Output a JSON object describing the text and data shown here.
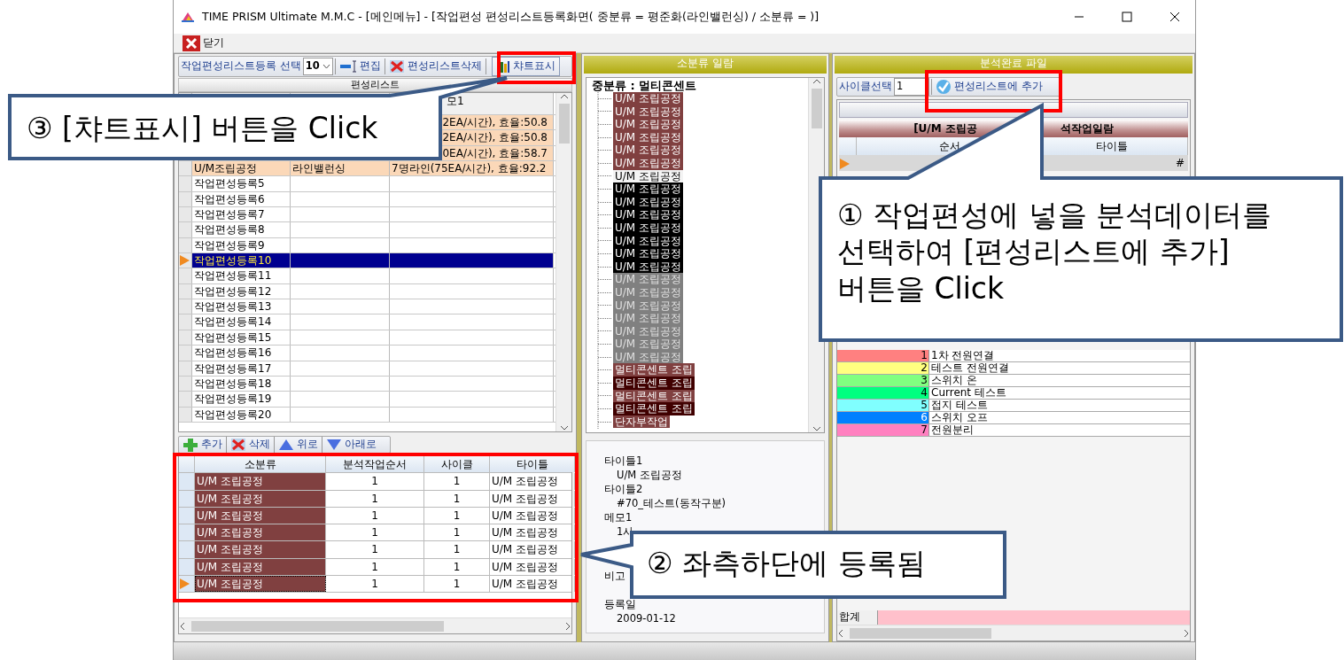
{
  "window": {
    "title": "TIME PRISM Ultimate M.M.C - [메인메뉴] - [작업편성 편성리스트등록화면( 중분류 = 평준화(라인밸런싱)  /  소분류 =  )]"
  },
  "menu": {
    "close_label": "닫기"
  },
  "left": {
    "toolbar": {
      "select_label": "작업편성리스트등록 선택",
      "count": "10",
      "buttons": [
        {
          "label": "편집",
          "kind": "edit"
        },
        {
          "label": "편성리스트삭제",
          "kind": "delete"
        },
        {
          "label": "챠트표시",
          "kind": "chart"
        }
      ]
    },
    "list_title": "편성리스트",
    "memo_header": "모1",
    "rows": [
      {
        "registered": true,
        "selected": false,
        "memo": "2EA/시간), 효율:50.8"
      },
      {
        "registered": true,
        "selected": false,
        "memo": "2EA/시간), 효율:50.8"
      },
      {
        "registered": true,
        "selected": false,
        "memo": "0EA/시간), 효율:58.7"
      },
      {
        "registered": true,
        "selected": false,
        "name": "U/M조립공정",
        "type": "라인밸런싱",
        "memo": "7명라인(75EA/시간), 효율:92.2"
      },
      {
        "registered": false,
        "selected": false,
        "name": "작업편성등록5"
      },
      {
        "registered": false,
        "selected": false,
        "name": "작업편성등록6"
      },
      {
        "registered": false,
        "selected": false,
        "name": "작업편성등록7"
      },
      {
        "registered": false,
        "selected": false,
        "name": "작업편성등록8"
      },
      {
        "registered": false,
        "selected": false,
        "name": "작업편성등록9"
      },
      {
        "registered": false,
        "selected": true,
        "name": "작업편성등록10"
      },
      {
        "registered": false,
        "selected": false,
        "name": "작업편성등록11"
      },
      {
        "registered": false,
        "selected": false,
        "name": "작업편성등록12"
      },
      {
        "registered": false,
        "selected": false,
        "name": "작업편성등록13"
      },
      {
        "registered": false,
        "selected": false,
        "name": "작업편성등록14"
      },
      {
        "registered": false,
        "selected": false,
        "name": "작업편성등록15"
      },
      {
        "registered": false,
        "selected": false,
        "name": "작업편성등록16"
      },
      {
        "registered": false,
        "selected": false,
        "name": "작업편성등록17"
      },
      {
        "registered": false,
        "selected": false,
        "name": "작업편성등록18"
      },
      {
        "registered": false,
        "selected": false,
        "name": "작업편성등록19"
      },
      {
        "registered": false,
        "selected": false,
        "name": "작업편성등록20"
      }
    ],
    "bottom_toolbar": [
      {
        "label": "추가",
        "kind": "add"
      },
      {
        "label": "삭제",
        "kind": "delete"
      },
      {
        "label": "위로",
        "kind": "up"
      },
      {
        "label": "아래로",
        "kind": "down"
      }
    ],
    "added_table": {
      "columns": [
        "소분류",
        "분석작업순서",
        "사이클",
        "타이틀"
      ],
      "rows": [
        {
          "category": "U/M 조립공정",
          "order": "1",
          "cycle": "1",
          "title": "U/M 조립공정",
          "selected": false
        },
        {
          "category": "U/M 조립공정",
          "order": "1",
          "cycle": "1",
          "title": "U/M 조립공정",
          "selected": false
        },
        {
          "category": "U/M 조립공정",
          "order": "1",
          "cycle": "1",
          "title": "U/M 조립공정",
          "selected": false
        },
        {
          "category": "U/M 조립공정",
          "order": "1",
          "cycle": "1",
          "title": "U/M 조립공정",
          "selected": false
        },
        {
          "category": "U/M 조립공정",
          "order": "1",
          "cycle": "1",
          "title": "U/M 조립공정",
          "selected": false
        },
        {
          "category": "U/M 조립공정",
          "order": "1",
          "cycle": "1",
          "title": "U/M 조립공정",
          "selected": false
        },
        {
          "category": "U/M 조립공정",
          "order": "1",
          "cycle": "1",
          "title": "U/M 조립공정",
          "selected": true
        }
      ]
    }
  },
  "middle": {
    "title": "소분류 일람",
    "tree": {
      "label": "중분류 : 멀티콘센트",
      "children": [
        {
          "label": "U/M 조립공정",
          "color": "#804040"
        },
        {
          "label": "U/M 조립공정",
          "color": "#804040"
        },
        {
          "label": "U/M 조립공정",
          "color": "#804040"
        },
        {
          "label": "U/M 조립공정",
          "color": "#804040"
        },
        {
          "label": "U/M 조립공정",
          "color": "#804040"
        },
        {
          "label": "U/M 조립공정",
          "color": "#804040"
        },
        {
          "label": "U/M 조립공정",
          "color": "#f4f4f4"
        },
        {
          "label": "U/M 조립공정",
          "color": "#000000"
        },
        {
          "label": "U/M 조립공정",
          "color": "#000000"
        },
        {
          "label": "U/M 조립공정",
          "color": "#000000"
        },
        {
          "label": "U/M 조립공정",
          "color": "#000000"
        },
        {
          "label": "U/M 조립공정",
          "color": "#000000"
        },
        {
          "label": "U/M 조립공정",
          "color": "#000000"
        },
        {
          "label": "U/M 조립공정",
          "color": "#000000"
        },
        {
          "label": "U/M 조립공정",
          "color": "#808080"
        },
        {
          "label": "U/M 조립공정",
          "color": "#808080"
        },
        {
          "label": "U/M 조립공정",
          "color": "#808080"
        },
        {
          "label": "U/M 조립공정",
          "color": "#808080"
        },
        {
          "label": "U/M 조립공정",
          "color": "#808080"
        },
        {
          "label": "U/M 조립공정",
          "color": "#808080"
        },
        {
          "label": "U/M 조립공정",
          "color": "#808080"
        },
        {
          "label": "멀티콘센트 조립",
          "color": "#804040"
        },
        {
          "label": "멀티콘센트 조립",
          "color": "#400000"
        },
        {
          "label": "멀티콘센트 조립",
          "color": "#804040"
        },
        {
          "label": "멀티콘센트 조립",
          "color": "#400000"
        },
        {
          "label": "단자부작업",
          "color": "#804040"
        }
      ]
    },
    "details": [
      {
        "label": "타이틀1",
        "value": "U/M 조립공정"
      },
      {
        "label": "타이틀2",
        "value": "#70_테스트(동작구분)"
      },
      {
        "label": "메모1",
        "value": "1사"
      },
      {
        "label": "비고"
      },
      {
        "label": "등록일",
        "value": "2009-01-12"
      }
    ]
  },
  "right": {
    "title": "분석완료 파일",
    "cycle_label": "사이클선택",
    "cycle_value": "1",
    "add_button": "편성리스트에 추가",
    "list_title_left": "[U/M 조립공",
    "list_title_right": "석작업일람",
    "columns": [
      "순서",
      "타이틀"
    ],
    "row_tail": "#",
    "steps": [
      {
        "number": "1",
        "name": "1차 전원연결",
        "color": "#ff8080"
      },
      {
        "number": "2",
        "name": "테스트 전원연결",
        "color": "#ffff80"
      },
      {
        "number": "3",
        "name": "스위치 온",
        "color": "#80ff80"
      },
      {
        "number": "4",
        "name": "Current 테스트",
        "color": "#00ff80"
      },
      {
        "number": "5",
        "name": "접지 테스트",
        "color": "#80ffff"
      },
      {
        "number": "6",
        "name": "스위치 오프",
        "color": "#0080ff"
      },
      {
        "number": "7",
        "name": "전원분리",
        "color": "#ff80c0"
      }
    ],
    "total_label": "합계"
  },
  "callouts": [
    {
      "lines": [
        "③ [챠트표시] 버튼을 Click"
      ]
    },
    {
      "lines": [
        "① 작업편성에 넣을 분석데이터를",
        "선택하여 [편성리스트에 추가]",
        "버튼을 Click"
      ]
    },
    {
      "lines": [
        "② 좌측하단에 등록됨"
      ]
    }
  ]
}
